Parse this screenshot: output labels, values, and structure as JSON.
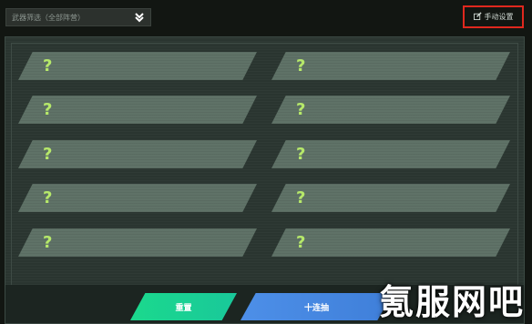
{
  "filter": {
    "value": "武器筛选（全部阵营）"
  },
  "manual_setting": {
    "label": "手动设置"
  },
  "slots": [
    {
      "text": "?"
    },
    {
      "text": "?"
    },
    {
      "text": "?"
    },
    {
      "text": "?"
    },
    {
      "text": "?"
    },
    {
      "text": "?"
    },
    {
      "text": "?"
    },
    {
      "text": "?"
    },
    {
      "text": "?"
    },
    {
      "text": "?"
    }
  ],
  "buttons": {
    "reset": "重置",
    "ten_draw": "十连抽"
  },
  "watermark": {
    "text": "氪服网吧"
  },
  "colors": {
    "accent_reset": "#1bd98d",
    "accent_draw": "#4d8fe8",
    "highlight_border": "#e0281e",
    "question_mark": "#b6e86a"
  }
}
